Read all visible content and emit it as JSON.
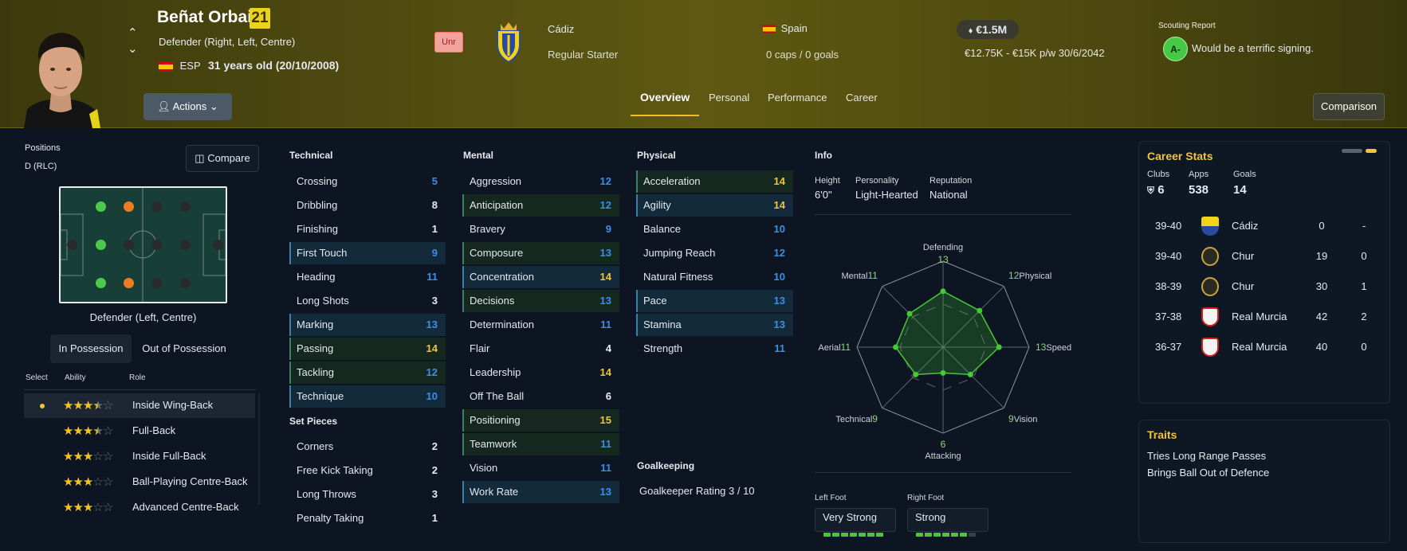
{
  "player": {
    "name": "Beñat Orbaiz",
    "number": "21",
    "position": "Defender (Right, Left, Centre)",
    "nation": "ESP",
    "age": "31 years old (20/10/2008)",
    "actions_label": "Actions",
    "status_badge": "Unr",
    "club": "Cádiz",
    "club_role": "Regular Starter",
    "country": "Spain",
    "caps": "0 caps / 0 goals",
    "value": "€1.5M",
    "wage_contract": "€12.75K - €15K p/w 30/6/2042",
    "scouting_report_title": "Scouting Report",
    "scouting_grade": "A-",
    "scouting_text": "Would be a terrific signing."
  },
  "tabs": [
    "Overview",
    "Personal",
    "Performance",
    "Career"
  ],
  "comparison_label": "Comparison",
  "positions_panel": {
    "title": "Positions",
    "code": "D (RLC)",
    "compare_label": "Compare",
    "pitch_caption": "Defender (Left, Centre)",
    "segments": [
      "In Possession",
      "Out of Possession"
    ],
    "headers": [
      "Select",
      "Ability",
      "Role"
    ],
    "roles": [
      {
        "name": "Inside Wing-Back",
        "stars": 3.5,
        "selected": true
      },
      {
        "name": "Full-Back",
        "stars": 3.5,
        "selected": false
      },
      {
        "name": "Inside Full-Back",
        "stars": 3,
        "selected": false
      },
      {
        "name": "Ball-Playing Centre-Back",
        "stars": 3,
        "selected": false
      },
      {
        "name": "Advanced Centre-Back",
        "stars": 3,
        "selected": false
      }
    ]
  },
  "technical": {
    "title": "Technical",
    "items": [
      {
        "name": "Crossing",
        "value": "5",
        "color": "blue",
        "hl": ""
      },
      {
        "name": "Dribbling",
        "value": "8",
        "color": "white",
        "hl": ""
      },
      {
        "name": "Finishing",
        "value": "1",
        "color": "white",
        "hl": ""
      },
      {
        "name": "First Touch",
        "value": "9",
        "color": "blue",
        "hl": "b"
      },
      {
        "name": "Heading",
        "value": "11",
        "color": "blue",
        "hl": ""
      },
      {
        "name": "Long Shots",
        "value": "3",
        "color": "white",
        "hl": ""
      },
      {
        "name": "Marking",
        "value": "13",
        "color": "blue",
        "hl": "b"
      },
      {
        "name": "Passing",
        "value": "14",
        "color": "yellow",
        "hl": "g"
      },
      {
        "name": "Tackling",
        "value": "12",
        "color": "blue",
        "hl": "g"
      },
      {
        "name": "Technique",
        "value": "10",
        "color": "blue",
        "hl": "b"
      }
    ]
  },
  "set_pieces": {
    "title": "Set Pieces",
    "items": [
      {
        "name": "Corners",
        "value": "2",
        "color": "white",
        "hl": ""
      },
      {
        "name": "Free Kick Taking",
        "value": "2",
        "color": "white",
        "hl": ""
      },
      {
        "name": "Long Throws",
        "value": "3",
        "color": "white",
        "hl": ""
      },
      {
        "name": "Penalty Taking",
        "value": "1",
        "color": "white",
        "hl": ""
      }
    ]
  },
  "mental": {
    "title": "Mental",
    "items": [
      {
        "name": "Aggression",
        "value": "12",
        "color": "blue",
        "hl": ""
      },
      {
        "name": "Anticipation",
        "value": "12",
        "color": "blue",
        "hl": "g"
      },
      {
        "name": "Bravery",
        "value": "9",
        "color": "blue",
        "hl": ""
      },
      {
        "name": "Composure",
        "value": "13",
        "color": "blue",
        "hl": "g"
      },
      {
        "name": "Concentration",
        "value": "14",
        "color": "yellow",
        "hl": "b"
      },
      {
        "name": "Decisions",
        "value": "13",
        "color": "blue",
        "hl": "g"
      },
      {
        "name": "Determination",
        "value": "11",
        "color": "blue",
        "hl": ""
      },
      {
        "name": "Flair",
        "value": "4",
        "color": "white",
        "hl": ""
      },
      {
        "name": "Leadership",
        "value": "14",
        "color": "yellow",
        "hl": ""
      },
      {
        "name": "Off The Ball",
        "value": "6",
        "color": "white",
        "hl": ""
      },
      {
        "name": "Positioning",
        "value": "15",
        "color": "yellow",
        "hl": "g"
      },
      {
        "name": "Teamwork",
        "value": "11",
        "color": "blue",
        "hl": "g"
      },
      {
        "name": "Vision",
        "value": "11",
        "color": "blue",
        "hl": ""
      },
      {
        "name": "Work Rate",
        "value": "13",
        "color": "blue",
        "hl": "b"
      }
    ]
  },
  "physical": {
    "title": "Physical",
    "items": [
      {
        "name": "Acceleration",
        "value": "14",
        "color": "yellow",
        "hl": "g"
      },
      {
        "name": "Agility",
        "value": "14",
        "color": "yellow",
        "hl": "b"
      },
      {
        "name": "Balance",
        "value": "10",
        "color": "blue",
        "hl": ""
      },
      {
        "name": "Jumping Reach",
        "value": "12",
        "color": "blue",
        "hl": ""
      },
      {
        "name": "Natural Fitness",
        "value": "10",
        "color": "blue",
        "hl": ""
      },
      {
        "name": "Pace",
        "value": "13",
        "color": "blue",
        "hl": "b"
      },
      {
        "name": "Stamina",
        "value": "13",
        "color": "blue",
        "hl": "b"
      },
      {
        "name": "Strength",
        "value": "11",
        "color": "blue",
        "hl": ""
      }
    ]
  },
  "goalkeeping": {
    "title": "Goalkeeping",
    "rating": "Goalkeeper Rating 3 / 10"
  },
  "info": {
    "title": "Info",
    "height_label": "Height",
    "height": "6'0\"",
    "personality_label": "Personality",
    "personality": "Light-Hearted",
    "reputation_label": "Reputation",
    "reputation": "National",
    "left_foot_label": "Left Foot",
    "left_foot": "Very Strong",
    "right_foot_label": "Right Foot",
    "right_foot": "Strong",
    "left_foot_level": 1.0,
    "right_foot_level": 0.8
  },
  "chart_data": {
    "type": "radar",
    "axes": [
      "Defending",
      "Physical",
      "Speed",
      "Vision",
      "Attacking",
      "Technical",
      "Aerial",
      "Mental"
    ],
    "values": [
      13,
      12,
      13,
      9,
      6,
      9,
      11,
      11
    ],
    "max": 20
  },
  "career_stats": {
    "title": "Career Stats",
    "clubs_label": "Clubs",
    "clubs": "6",
    "apps_label": "Apps",
    "apps": "538",
    "goals_label": "Goals",
    "goals": "14",
    "rows": [
      {
        "season": "39-40",
        "club": "Cádiz",
        "apps": "0",
        "goals": "-"
      },
      {
        "season": "39-40",
        "club": "Chur",
        "apps": "19",
        "goals": "0"
      },
      {
        "season": "38-39",
        "club": "Chur",
        "apps": "30",
        "goals": "1"
      },
      {
        "season": "37-38",
        "club": "Real Murcia",
        "apps": "42",
        "goals": "2"
      },
      {
        "season": "36-37",
        "club": "Real Murcia",
        "apps": "40",
        "goals": "0"
      }
    ]
  },
  "traits": {
    "title": "Traits",
    "items": [
      "Tries Long Range Passes",
      "Brings Ball Out of Defence"
    ]
  }
}
